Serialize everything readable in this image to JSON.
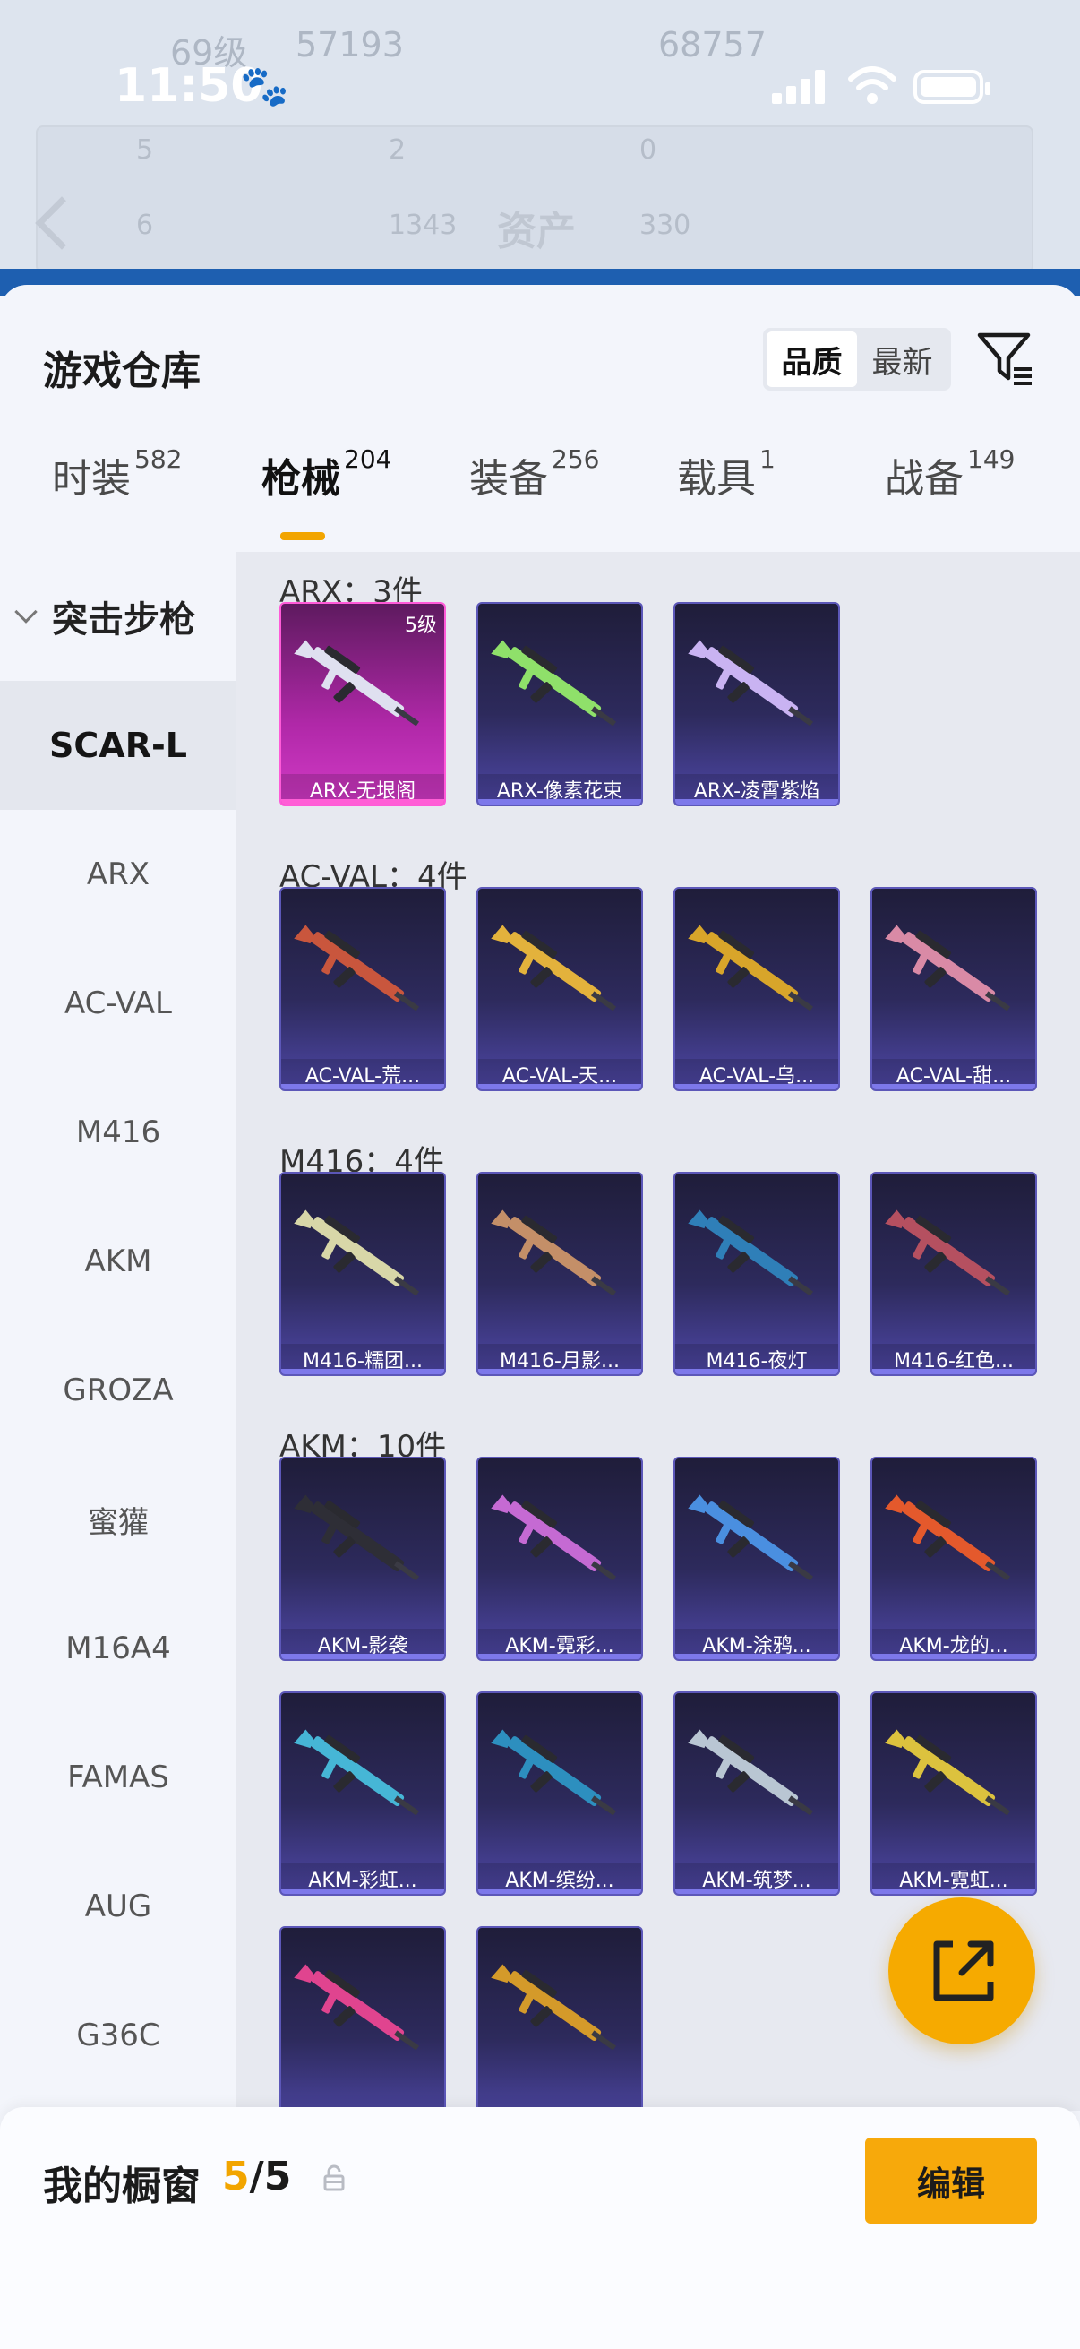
{
  "status_bar": {
    "time": "11:50"
  },
  "background": {
    "profile": {
      "level": "69级",
      "stat": "57193",
      "stat2": "68757"
    },
    "stats_row1": [
      "5",
      "2",
      "0"
    ],
    "stats_row2": [
      "6",
      "1343",
      "330"
    ],
    "asset_title": "资产"
  },
  "sheet": {
    "title": "游戏仓库",
    "sort_options": [
      "品质",
      "最新"
    ],
    "sort_selected": "品质",
    "tabs": [
      {
        "label": "时装",
        "count": "582"
      },
      {
        "label": "枪械",
        "count": "204"
      },
      {
        "label": "装备",
        "count": "256"
      },
      {
        "label": "载具",
        "count": "1"
      },
      {
        "label": "战备",
        "count": "149"
      }
    ],
    "active_tab": "枪械"
  },
  "sidebar": {
    "category": "突击步枪",
    "items": [
      "SCAR-L",
      "ARX",
      "AC-VAL",
      "M416",
      "AKM",
      "GROZA",
      "蜜獾",
      "M16A4",
      "FAMAS",
      "AUG",
      "G36C"
    ],
    "active_item": "SCAR-L"
  },
  "groups": [
    {
      "title": "ARX：3件",
      "items": [
        {
          "label": "ARX-无垠阁",
          "level": "5级",
          "rarity": "pink",
          "accent": "#dfe0f0"
        },
        {
          "label": "ARX-像素花束",
          "rarity": "purple",
          "accent": "#8fe06a"
        },
        {
          "label": "ARX-凌霄紫焰",
          "rarity": "purple",
          "accent": "#c9b3f2"
        }
      ]
    },
    {
      "title": "AC-VAL：4件",
      "items": [
        {
          "label": "AC-VAL-荒...",
          "rarity": "purple",
          "accent": "#c9563d"
        },
        {
          "label": "AC-VAL-天...",
          "rarity": "purple",
          "accent": "#e3b23c"
        },
        {
          "label": "AC-VAL-乌...",
          "rarity": "purple",
          "accent": "#d8a52a"
        },
        {
          "label": "AC-VAL-甜...",
          "rarity": "purple",
          "accent": "#d98aa6"
        }
      ]
    },
    {
      "title": "M416：4件",
      "items": [
        {
          "label": "M416-糯团...",
          "rarity": "purple",
          "accent": "#d8d7a8"
        },
        {
          "label": "M416-月影...",
          "rarity": "purple",
          "accent": "#c48f68"
        },
        {
          "label": "M416-夜灯",
          "rarity": "purple",
          "accent": "#2f7fb8"
        },
        {
          "label": "M416-红色...",
          "rarity": "purple",
          "accent": "#b55060"
        }
      ]
    },
    {
      "title": "AKM：10件",
      "items": [
        {
          "label": "AKM-影袭",
          "rarity": "purple",
          "accent": "#2e2e36"
        },
        {
          "label": "AKM-霓彩...",
          "rarity": "purple",
          "accent": "#c56ad3"
        },
        {
          "label": "AKM-涂鸦...",
          "rarity": "purple",
          "accent": "#4a8fe0"
        },
        {
          "label": "AKM-龙的...",
          "rarity": "purple",
          "accent": "#e4592c"
        },
        {
          "label": "AKM-彩虹...",
          "rarity": "purple",
          "accent": "#46b6d6"
        },
        {
          "label": "AKM-缤纷...",
          "rarity": "purple",
          "accent": "#2d8fbf"
        },
        {
          "label": "AKM-筑梦...",
          "rarity": "purple",
          "accent": "#b9c6d3"
        },
        {
          "label": "AKM-霓虹...",
          "rarity": "purple",
          "accent": "#dcc23e"
        },
        {
          "label": "",
          "rarity": "purple",
          "accent": "#e0448f"
        },
        {
          "label": "",
          "rarity": "purple",
          "accent": "#d49a2a"
        }
      ]
    }
  ],
  "bottom": {
    "title": "我的橱窗",
    "current": "5",
    "total": "5",
    "edit_label": "编辑"
  },
  "colors": {
    "accent": "#f2a500",
    "card_purple": "#2d2a5c",
    "card_pink": "#b028a8"
  }
}
